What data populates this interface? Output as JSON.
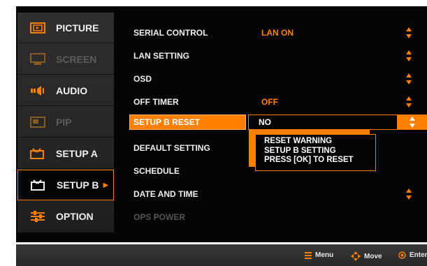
{
  "sidebar": {
    "items": [
      {
        "label": "PICTURE",
        "icon": "picture-icon"
      },
      {
        "label": "SCREEN",
        "icon": "screen-icon"
      },
      {
        "label": "AUDIO",
        "icon": "audio-icon"
      },
      {
        "label": "PIP",
        "icon": "pip-icon"
      },
      {
        "label": "SETUP A",
        "icon": "setup-a-icon"
      },
      {
        "label": "SETUP B",
        "icon": "setup-b-icon"
      },
      {
        "label": "OPTION",
        "icon": "option-icon"
      }
    ],
    "selected_arrow": "▶"
  },
  "settings": {
    "rows": [
      {
        "label": "SERIAL CONTROL",
        "value": "LAN ON"
      },
      {
        "label": "LAN SETTING",
        "value": ""
      },
      {
        "label": "OSD",
        "value": ""
      },
      {
        "label": "OFF TIMER",
        "value": "OFF"
      },
      {
        "label": "SETUP B RESET",
        "value": "NO"
      },
      {
        "label": "DEFAULT SETTING",
        "value": ""
      },
      {
        "label": "SCHEDULE",
        "value": ""
      },
      {
        "label": "DATE AND TIME",
        "value": ""
      },
      {
        "label": "OPS POWER",
        "value": ""
      }
    ]
  },
  "reset_popup": {
    "lines": [
      "RESET WARNING",
      "SETUP B SETTING",
      "PRESS [OK] TO RESET"
    ]
  },
  "footer": {
    "menu_label": "Menu",
    "move_label": "Move",
    "enter_label": "Enter"
  },
  "colors": {
    "accent": "#ff7f00",
    "background": "#050505",
    "text": "#f0f0f0",
    "dimmed": "#5e5e5e"
  }
}
